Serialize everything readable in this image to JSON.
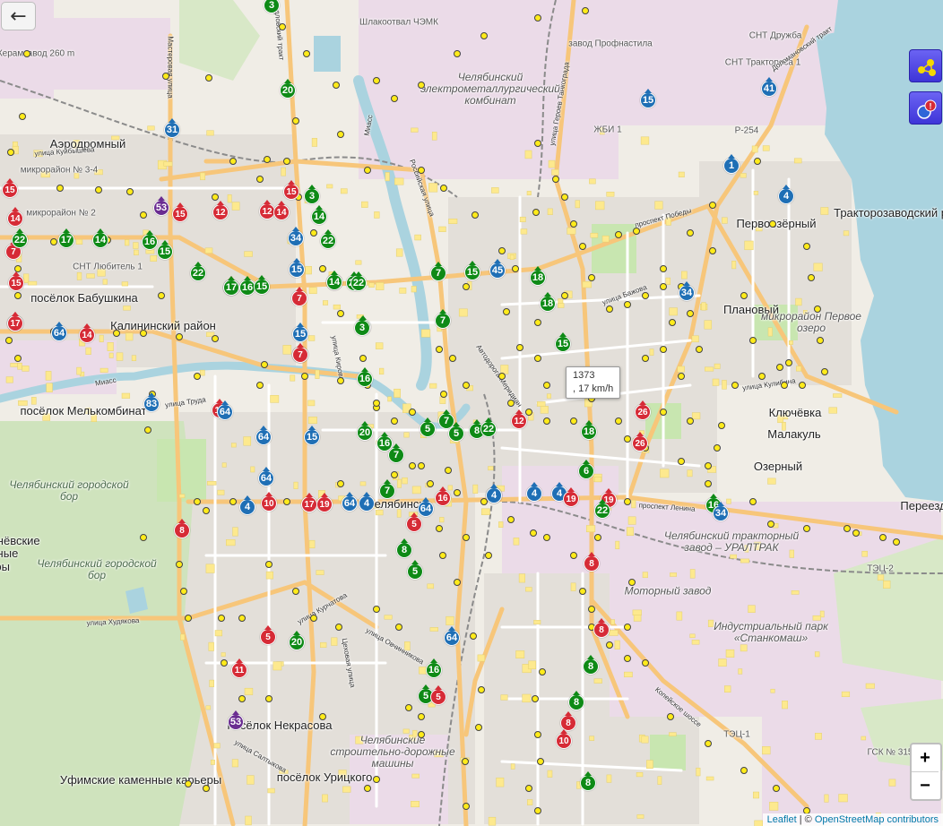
{
  "map": {
    "popup": {
      "line1": "1373",
      "line2": ", 17 km/h"
    },
    "attribution": {
      "leaflet": "Leaflet",
      "separator": " | © ",
      "osm": "OpenStreetMap contributors"
    },
    "zoom": {
      "in": "+",
      "out": "−"
    },
    "controls": {
      "back_icon": "arrow-left-icon",
      "layers_icon": "layers-icon",
      "notifications_icon": "notification-badge-icon",
      "notifications_badge": "!"
    },
    "route_colors": {
      "bus": "#1f6fb5",
      "tram": "#d62b36",
      "trolleybus": "#0e8a16",
      "minibus": "#6a2c91"
    },
    "labels": [
      {
        "text": "Челябинский электрометаллургический комбинат",
        "kind": "industrial"
      },
      {
        "text": "Челябинский тракторный завод – УРАЛТРАК",
        "kind": "industrial"
      },
      {
        "text": "Индустриальный парк «Станкомаш»",
        "kind": "industrial"
      },
      {
        "text": "Моторный завод",
        "kind": "industrial"
      },
      {
        "text": "Шлакоотвал ЧЭМК",
        "kind": "small"
      },
      {
        "text": "Керамзавод 260 m",
        "kind": "small"
      },
      {
        "text": "Аэродромный",
        "kind": "district"
      },
      {
        "text": "микрорайон № 3-4",
        "kind": "small"
      },
      {
        "text": "микрорайон № 2",
        "kind": "small"
      },
      {
        "text": "СНТ Любитель 1",
        "kind": "small"
      },
      {
        "text": "посёлок Бабушкина",
        "kind": "district"
      },
      {
        "text": "Калининский район",
        "kind": "district"
      },
      {
        "text": "посёлок Мелькомбинат",
        "kind": "district"
      },
      {
        "text": "Челябинский городской бор",
        "kind": "forest"
      },
      {
        "text": "Челябинский городской бор",
        "kind": "forest"
      },
      {
        "text": "Шершнёвские каменные карьеры",
        "kind": "cut"
      },
      {
        "text": "посёлок Некрасова",
        "kind": "district"
      },
      {
        "text": "Уфимские каменные карьеры",
        "kind": "district"
      },
      {
        "text": "посёлок Урицкого",
        "kind": "district"
      },
      {
        "text": "Челябинские строительно-дорожные машины",
        "kind": "industrial"
      },
      {
        "text": "Первоозёрный",
        "kind": "district"
      },
      {
        "text": "Тракторозаводский район",
        "kind": "district"
      },
      {
        "text": "Плановый",
        "kind": "district"
      },
      {
        "text": "микрорайон Первое озеро",
        "kind": "industrial"
      },
      {
        "text": "Ключёвка",
        "kind": "district"
      },
      {
        "text": "Малакуль",
        "kind": "district"
      },
      {
        "text": "Озерный",
        "kind": "district"
      },
      {
        "text": "Переезд",
        "kind": "district"
      },
      {
        "text": "СНТ Дружба",
        "kind": "small"
      },
      {
        "text": "СНТ Трактороса 1",
        "kind": "small"
      },
      {
        "text": "завод Профнастила",
        "kind": "small"
      },
      {
        "text": "ЖБИ 1",
        "kind": "small"
      },
      {
        "text": "ТЭЦ-2",
        "kind": "small"
      },
      {
        "text": "ТЭЦ-1",
        "kind": "small"
      },
      {
        "text": "ГСК № 315",
        "kind": "small"
      },
      {
        "text": "Р-254",
        "kind": "small"
      },
      {
        "text": "Челябинск",
        "kind": "district"
      },
      {
        "text": "улица Куйбышева",
        "kind": "street"
      },
      {
        "text": "проспект Победы",
        "kind": "street"
      },
      {
        "text": "улица Труда",
        "kind": "street"
      },
      {
        "text": "улица Худякова",
        "kind": "street"
      },
      {
        "text": "улица Кирова",
        "kind": "street"
      },
      {
        "text": "проспект Ленина",
        "kind": "street"
      },
      {
        "text": "Автодорога Меридиан",
        "kind": "street"
      },
      {
        "text": "Копейское шоссе",
        "kind": "street"
      },
      {
        "text": "улица Героев Танкограда",
        "kind": "street"
      },
      {
        "text": "Свердловский тракт",
        "kind": "street"
      },
      {
        "text": "Российская улица",
        "kind": "street"
      },
      {
        "text": "Мастеровая улица",
        "kind": "street"
      },
      {
        "text": "улица Бажова",
        "kind": "street"
      },
      {
        "text": "улица Кулибина",
        "kind": "street"
      },
      {
        "text": "улица Овчинникова",
        "kind": "street"
      },
      {
        "text": "улица Курчатова",
        "kind": "street"
      },
      {
        "text": "Цеховая улица",
        "kind": "street"
      },
      {
        "text": "улица Салтыкова",
        "kind": "street"
      },
      {
        "text": "Доломановский тракт",
        "kind": "street"
      },
      {
        "text": "Миасс",
        "kind": "street"
      },
      {
        "text": "Миасс",
        "kind": "street"
      }
    ],
    "vehicles": [
      {
        "r": "3",
        "t": "trolleybus"
      },
      {
        "r": "20",
        "t": "trolleybus"
      },
      {
        "r": "31",
        "t": "bus"
      },
      {
        "r": "15",
        "t": "bus"
      },
      {
        "r": "41",
        "t": "bus"
      },
      {
        "r": "1",
        "t": "bus"
      },
      {
        "r": "4",
        "t": "bus"
      },
      {
        "r": "15",
        "t": "tram"
      },
      {
        "r": "15",
        "t": "tram"
      },
      {
        "r": "14",
        "t": "tram"
      },
      {
        "r": "53",
        "t": "minibus"
      },
      {
        "r": "15",
        "t": "tram"
      },
      {
        "r": "12",
        "t": "tram"
      },
      {
        "r": "12",
        "t": "tram"
      },
      {
        "r": "14",
        "t": "tram"
      },
      {
        "r": "7",
        "t": "tram"
      },
      {
        "r": "15",
        "t": "tram"
      },
      {
        "r": "3",
        "t": "trolleybus"
      },
      {
        "r": "14",
        "t": "trolleybus"
      },
      {
        "r": "22",
        "t": "trolleybus"
      },
      {
        "r": "34",
        "t": "bus"
      },
      {
        "r": "22",
        "t": "trolleybus"
      },
      {
        "r": "17",
        "t": "trolleybus"
      },
      {
        "r": "14",
        "t": "trolleybus"
      },
      {
        "r": "16",
        "t": "trolleybus"
      },
      {
        "r": "15",
        "t": "trolleybus"
      },
      {
        "r": "22",
        "t": "trolleybus"
      },
      {
        "r": "17",
        "t": "tram"
      },
      {
        "r": "7",
        "t": "tram"
      },
      {
        "r": "17",
        "t": "tram"
      },
      {
        "r": "17",
        "t": "trolleybus"
      },
      {
        "r": "16",
        "t": "trolleybus"
      },
      {
        "r": "15",
        "t": "trolleybus"
      },
      {
        "r": "14",
        "t": "trolleybus"
      },
      {
        "r": "22",
        "t": "trolleybus"
      },
      {
        "r": "15",
        "t": "bus"
      },
      {
        "r": "7",
        "t": "tram"
      },
      {
        "r": "14",
        "t": "trolleybus"
      },
      {
        "r": "22",
        "t": "trolleybus"
      },
      {
        "r": "7",
        "t": "trolleybus"
      },
      {
        "r": "15",
        "t": "trolleybus"
      },
      {
        "r": "45",
        "t": "bus"
      },
      {
        "r": "18",
        "t": "trolleybus"
      },
      {
        "r": "18",
        "t": "trolleybus"
      },
      {
        "r": "34",
        "t": "bus"
      },
      {
        "r": "7",
        "t": "trolleybus"
      },
      {
        "r": "3",
        "t": "trolleybus"
      },
      {
        "r": "64",
        "t": "bus"
      },
      {
        "r": "14",
        "t": "tram"
      },
      {
        "r": "17",
        "t": "tram"
      },
      {
        "r": "15",
        "t": "bus"
      },
      {
        "r": "7",
        "t": "tram"
      },
      {
        "r": "16",
        "t": "trolleybus"
      },
      {
        "r": "15",
        "t": "trolleybus"
      },
      {
        "r": "83",
        "t": "bus"
      },
      {
        "r": "14",
        "t": "tram"
      },
      {
        "r": "64",
        "t": "bus"
      },
      {
        "r": "64",
        "t": "bus"
      },
      {
        "r": "15",
        "t": "bus"
      },
      {
        "r": "20",
        "t": "trolleybus"
      },
      {
        "r": "7",
        "t": "trolleybus"
      },
      {
        "r": "5",
        "t": "trolleybus"
      },
      {
        "r": "5",
        "t": "trolleybus"
      },
      {
        "r": "8",
        "t": "trolleybus"
      },
      {
        "r": "22",
        "t": "trolleybus"
      },
      {
        "r": "12",
        "t": "tram"
      },
      {
        "r": "18",
        "t": "trolleybus"
      },
      {
        "r": "26",
        "t": "tram"
      },
      {
        "r": "26",
        "t": "tram"
      },
      {
        "r": "16",
        "t": "trolleybus"
      },
      {
        "r": "7",
        "t": "trolleybus"
      },
      {
        "r": "6",
        "t": "trolleybus"
      },
      {
        "r": "64",
        "t": "bus"
      },
      {
        "r": "4",
        "t": "bus"
      },
      {
        "r": "10",
        "t": "tram"
      },
      {
        "r": "17",
        "t": "tram"
      },
      {
        "r": "19",
        "t": "tram"
      },
      {
        "r": "64",
        "t": "bus"
      },
      {
        "r": "4",
        "t": "bus"
      },
      {
        "r": "7",
        "t": "trolleybus"
      },
      {
        "r": "64",
        "t": "bus"
      },
      {
        "r": "16",
        "t": "tram"
      },
      {
        "r": "4",
        "t": "bus"
      },
      {
        "r": "4",
        "t": "bus"
      },
      {
        "r": "4",
        "t": "bus"
      },
      {
        "r": "19",
        "t": "tram"
      },
      {
        "r": "19",
        "t": "tram"
      },
      {
        "r": "22",
        "t": "trolleybus"
      },
      {
        "r": "16",
        "t": "trolleybus"
      },
      {
        "r": "34",
        "t": "bus"
      },
      {
        "r": "8",
        "t": "tram"
      },
      {
        "r": "5",
        "t": "tram"
      },
      {
        "r": "8",
        "t": "trolleybus"
      },
      {
        "r": "5",
        "t": "trolleybus"
      },
      {
        "r": "8",
        "t": "tram"
      },
      {
        "r": "3",
        "t": "trolleybus"
      },
      {
        "r": "64",
        "t": "bus"
      },
      {
        "r": "20",
        "t": "trolleybus"
      },
      {
        "r": "5",
        "t": "tram"
      },
      {
        "r": "11",
        "t": "tram"
      },
      {
        "r": "16",
        "t": "trolleybus"
      },
      {
        "r": "5",
        "t": "trolleybus"
      },
      {
        "r": "5",
        "t": "tram"
      },
      {
        "r": "8",
        "t": "tram"
      },
      {
        "r": "8",
        "t": "trolleybus"
      },
      {
        "r": "8",
        "t": "trolleybus"
      },
      {
        "r": "8",
        "t": "tram"
      },
      {
        "r": "10",
        "t": "tram"
      },
      {
        "r": "53",
        "t": "minibus"
      },
      {
        "r": "8",
        "t": "trolleybus"
      },
      {
        "r": "15",
        "t": "tram"
      },
      {
        "r": "14",
        "t": "tram"
      },
      {
        "r": "5",
        "t": "trolleybus"
      },
      {
        "r": "8",
        "t": "trolleybus"
      },
      {
        "r": "4",
        "t": "bus"
      }
    ]
  }
}
